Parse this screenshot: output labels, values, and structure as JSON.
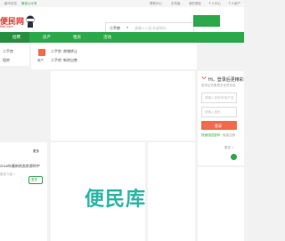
{
  "topbar": {
    "left_text": "...都市总站",
    "wechat": "微信公众号",
    "right": [
      "帮助中心",
      "手机版",
      "我的便民",
      "个人中心",
      "个人用户"
    ]
  },
  "header": {
    "logo_text": "便民网",
    "logo_sub": "BM.com",
    "search": {
      "city": "二手房",
      "placeholder": "请输入小区名或地址"
    }
  },
  "nav": {
    "items": [
      "招聘",
      "房产",
      "租房",
      "活动"
    ]
  },
  "categories": {
    "left": [
      "二手房",
      "租房"
    ],
    "house_label": "房产",
    "col1": [
      "二手房",
      "二手房"
    ],
    "col2": [
      "商铺转让",
      "新房出售"
    ]
  },
  "login": {
    "title": "Hi，登录后更精彩",
    "subtitle": "登录后查看更多优质信息",
    "username_placeholder": "请输入手机号/用户名",
    "password_placeholder": "请输入密码",
    "button": "登录",
    "forgot": "快速找回密码",
    "register": "免费注册",
    "more": "更多 >"
  },
  "side": {
    "title": "更多",
    "item": "2018年最新热卖房源的中",
    "meta": "更多介绍 >",
    "button": "更多"
  },
  "watermark": "便民库",
  "colors": {
    "green": "#2aa84a",
    "orange": "#ef6b4c",
    "red": "#e0302a",
    "teal": "#28b6a8"
  }
}
